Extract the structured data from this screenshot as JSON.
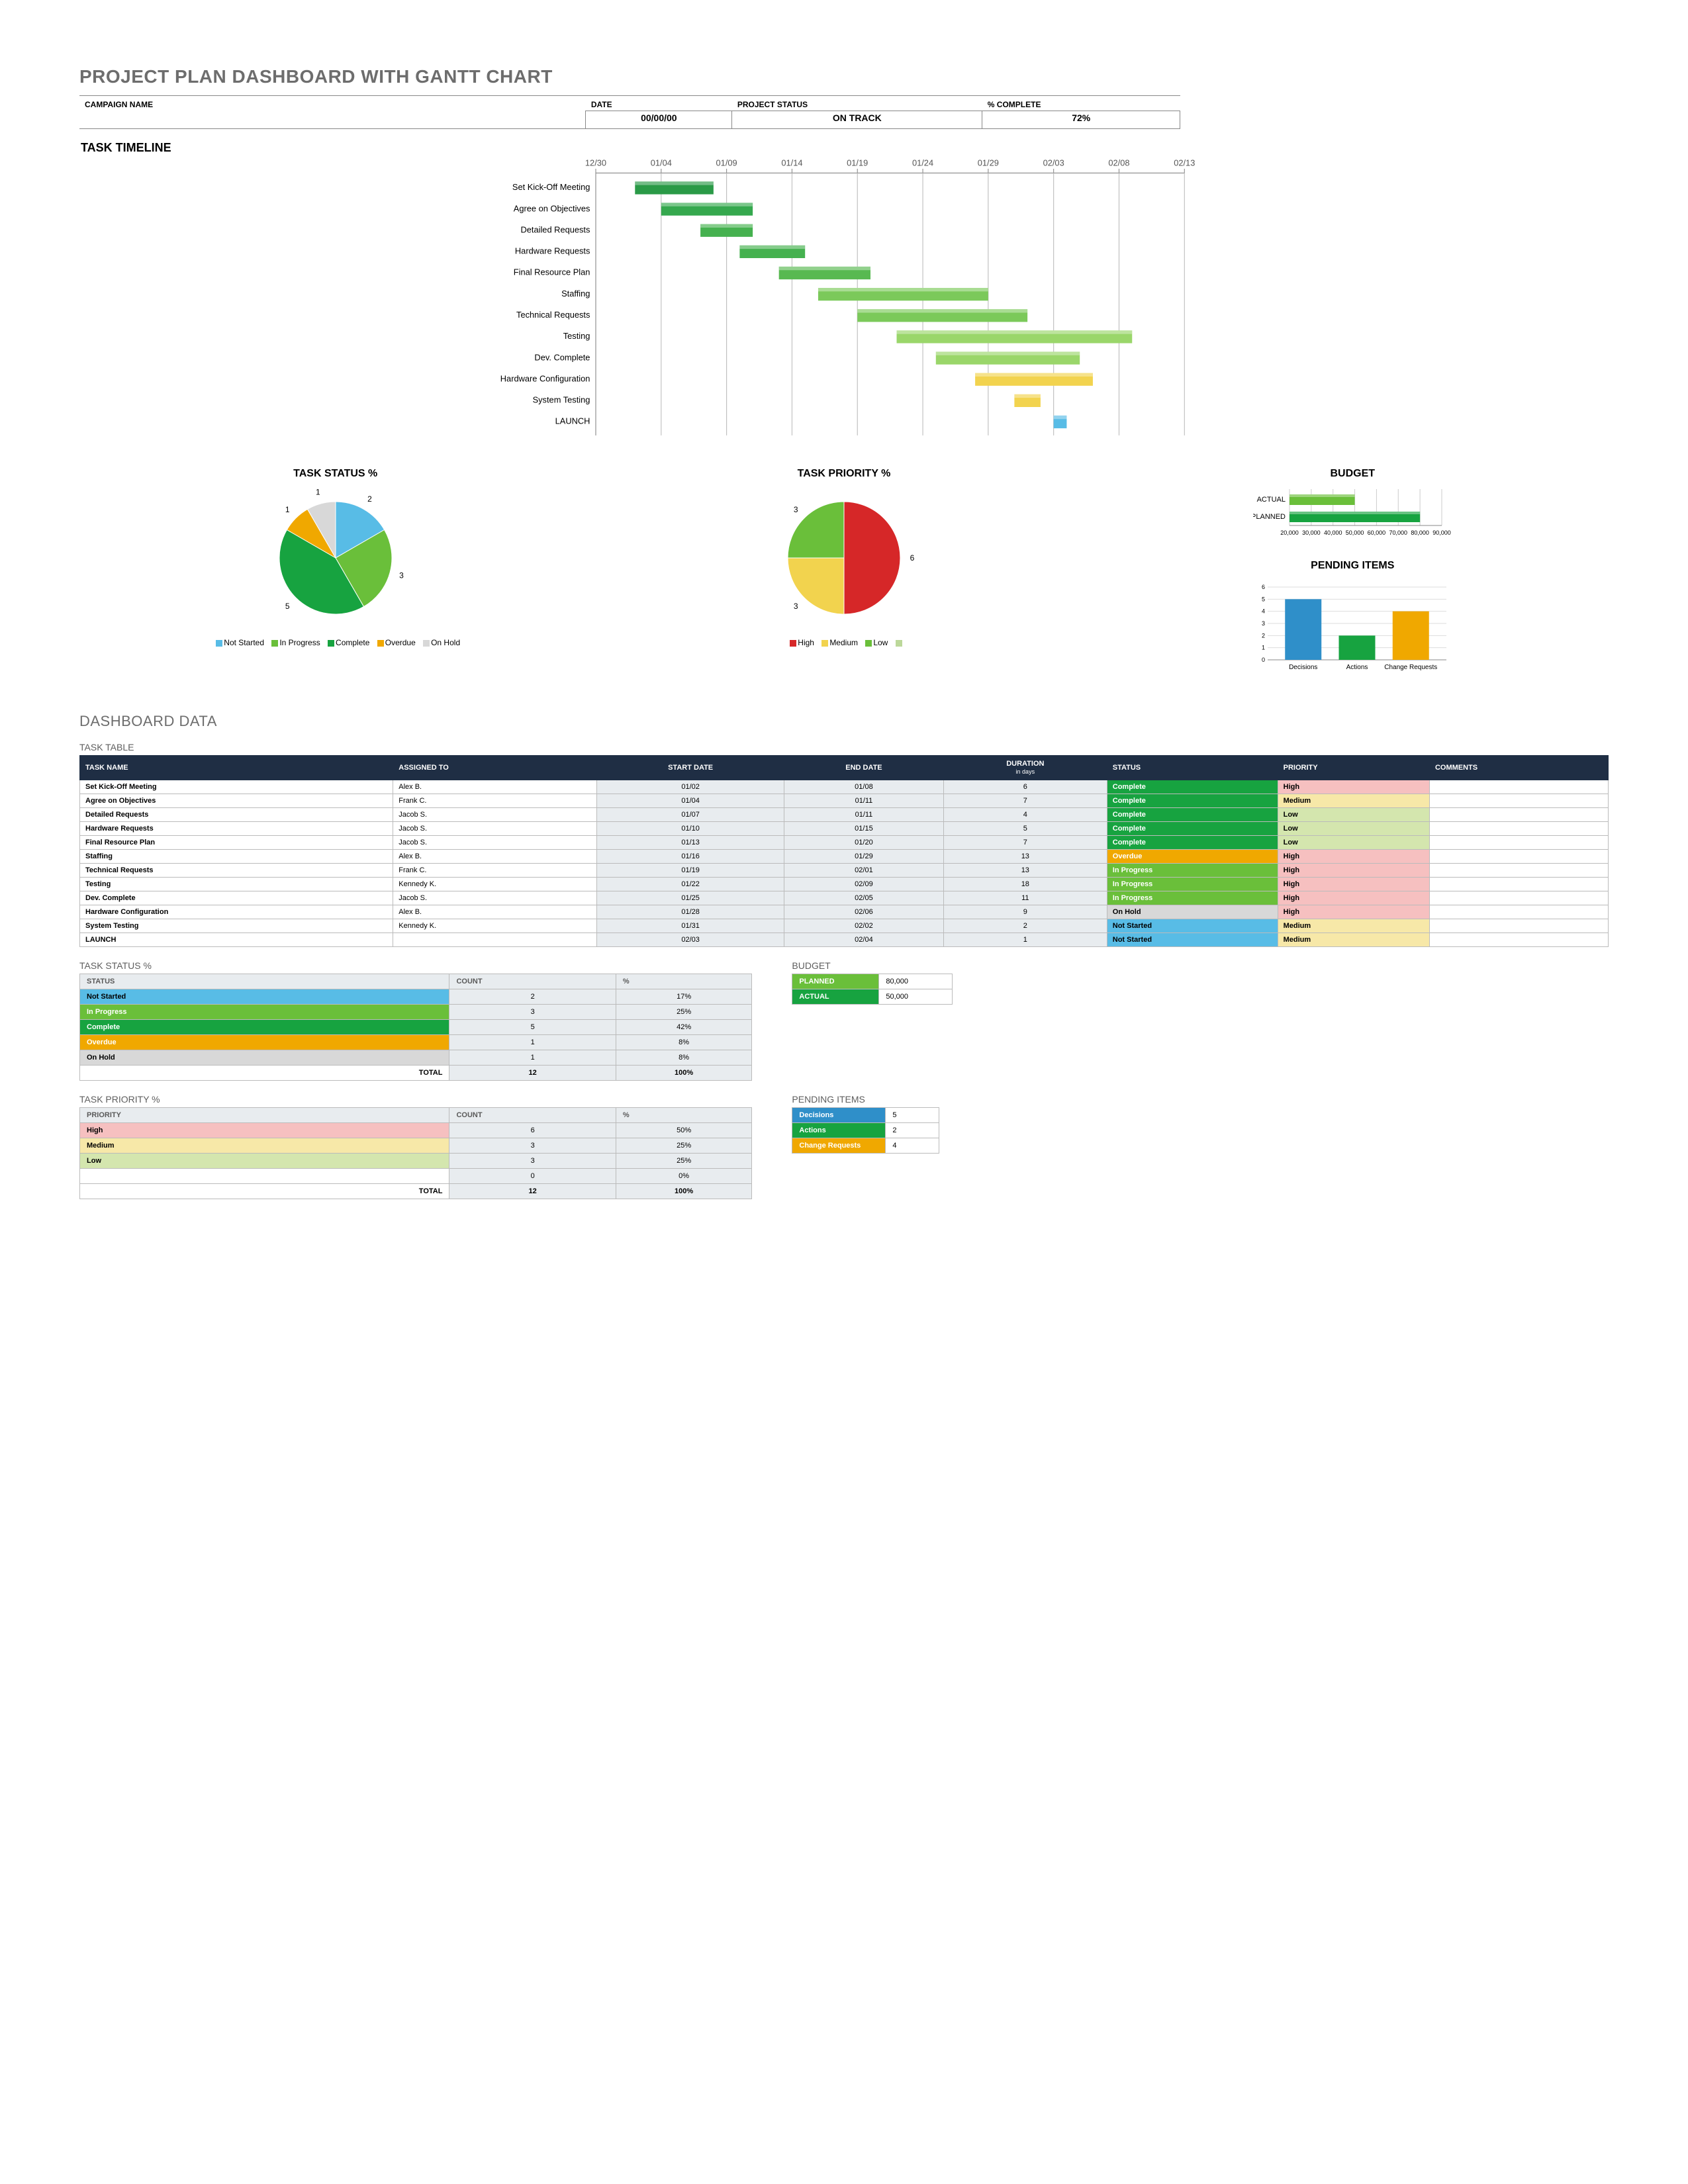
{
  "header": {
    "title": "PROJECT PLAN DASHBOARD WITH GANTT CHART",
    "campaign_label": "CAMPAIGN NAME",
    "date_label": "DATE",
    "status_label": "PROJECT STATUS",
    "pct_label": "% COMPLETE",
    "date_value": "00/00/00",
    "status_value": "ON TRACK",
    "pct_value": "72%"
  },
  "gantt": {
    "title": "TASK TIMELINE",
    "ticks": [
      "12/30",
      "01/04",
      "01/09",
      "01/14",
      "01/19",
      "01/24",
      "01/29",
      "02/03",
      "02/08",
      "02/13"
    ]
  },
  "tasks": [
    {
      "name": "Set Kick-Off Meeting",
      "assigned": "Alex B.",
      "start": "01/02",
      "end": "01/08",
      "dur": "6",
      "start_i": 0.6,
      "dur_i": 6,
      "status": "Complete",
      "priority": "High",
      "bar": "g1"
    },
    {
      "name": "Agree on Objectives",
      "assigned": "Frank C.",
      "start": "01/04",
      "end": "01/11",
      "dur": "7",
      "start_i": 1.0,
      "dur_i": 7,
      "status": "Complete",
      "priority": "Medium",
      "bar": "g2"
    },
    {
      "name": "Detailed Requests",
      "assigned": "Jacob S.",
      "start": "01/07",
      "end": "01/11",
      "dur": "4",
      "start_i": 1.6,
      "dur_i": 4,
      "status": "Complete",
      "priority": "Low",
      "bar": "g3"
    },
    {
      "name": "Hardware Requests",
      "assigned": "Jacob S.",
      "start": "01/10",
      "end": "01/15",
      "dur": "5",
      "start_i": 2.2,
      "dur_i": 5,
      "status": "Complete",
      "priority": "Low",
      "bar": "g3"
    },
    {
      "name": "Final Resource Plan",
      "assigned": "Jacob S.",
      "start": "01/13",
      "end": "01/20",
      "dur": "7",
      "start_i": 2.8,
      "dur_i": 7,
      "status": "Complete",
      "priority": "Low",
      "bar": "g4"
    },
    {
      "name": "Staffing",
      "assigned": "Alex B.",
      "start": "01/16",
      "end": "01/29",
      "dur": "13",
      "start_i": 3.4,
      "dur_i": 13,
      "status": "Overdue",
      "priority": "High",
      "bar": "g5"
    },
    {
      "name": "Technical Requests",
      "assigned": "Frank C.",
      "start": "01/19",
      "end": "02/01",
      "dur": "13",
      "start_i": 4.0,
      "dur_i": 13,
      "status": "In Progress",
      "priority": "High",
      "bar": "g5"
    },
    {
      "name": "Testing",
      "assigned": "Kennedy K.",
      "start": "01/22",
      "end": "02/09",
      "dur": "18",
      "start_i": 4.6,
      "dur_i": 18,
      "status": "In Progress",
      "priority": "High",
      "bar": "g6"
    },
    {
      "name": "Dev. Complete",
      "assigned": "Jacob S.",
      "start": "01/25",
      "end": "02/05",
      "dur": "11",
      "start_i": 5.2,
      "dur_i": 11,
      "status": "In Progress",
      "priority": "High",
      "bar": "g6"
    },
    {
      "name": "Hardware Configuration",
      "assigned": "Alex B.",
      "start": "01/28",
      "end": "02/06",
      "dur": "9",
      "start_i": 5.8,
      "dur_i": 9,
      "status": "On Hold",
      "priority": "High",
      "bar": "y1"
    },
    {
      "name": "System Testing",
      "assigned": "Kennedy K.",
      "start": "01/31",
      "end": "02/02",
      "dur": "2",
      "start_i": 6.4,
      "dur_i": 2,
      "status": "Not Started",
      "priority": "Medium",
      "bar": "y1"
    },
    {
      "name": "LAUNCH",
      "assigned": "",
      "start": "02/03",
      "end": "02/04",
      "dur": "1",
      "start_i": 7.0,
      "dur_i": 1,
      "status": "Not Started",
      "priority": "Medium",
      "bar": "b1"
    }
  ],
  "chart_data": [
    {
      "id": "task_status_pie",
      "type": "pie",
      "title": "TASK STATUS %",
      "slices": [
        {
          "label": "Not Started",
          "value": 2,
          "color": "#58bce6"
        },
        {
          "label": "In Progress",
          "value": 3,
          "color": "#6abf3a"
        },
        {
          "label": "Complete",
          "value": 5,
          "color": "#17a340"
        },
        {
          "label": "Overdue",
          "value": 1,
          "color": "#f0a800"
        },
        {
          "label": "On Hold",
          "value": 1,
          "color": "#d8d8d8"
        }
      ]
    },
    {
      "id": "task_priority_pie",
      "type": "pie",
      "title": "TASK PRIORITY %",
      "slices": [
        {
          "label": "High",
          "value": 6,
          "color": "#d62728"
        },
        {
          "label": "Medium",
          "value": 3,
          "color": "#f2d34e"
        },
        {
          "label": "Low",
          "value": 3,
          "color": "#6abf3a"
        },
        {
          "label": "",
          "value": 0,
          "color": "#bcd89a"
        }
      ]
    },
    {
      "id": "budget_bar",
      "type": "bar",
      "title": "BUDGET",
      "categories": [
        "ACTUAL",
        "PLANNED"
      ],
      "values": [
        50000,
        80000
      ],
      "xlim": [
        20000,
        90000
      ],
      "ticks": [
        20000,
        30000,
        40000,
        50000,
        60000,
        70000,
        80000,
        90000
      ]
    },
    {
      "id": "pending_bar",
      "type": "bar",
      "title": "PENDING ITEMS",
      "categories": [
        "Decisions",
        "Actions",
        "Change Requests"
      ],
      "values": [
        5,
        2,
        4
      ],
      "colors": [
        "#2f8fc9",
        "#17a340",
        "#f0a800"
      ],
      "ylim": [
        0,
        6
      ]
    }
  ],
  "dashboard_data_title": "DASHBOARD DATA",
  "task_table": {
    "title": "TASK TABLE",
    "headers": [
      "TASK NAME",
      "ASSIGNED TO",
      "START DATE",
      "END DATE",
      "DURATION in days",
      "STATUS",
      "PRIORITY",
      "COMMENTS"
    ]
  },
  "status_table": {
    "title": "TASK STATUS %",
    "headers": [
      "STATUS",
      "COUNT",
      "%"
    ],
    "rows": [
      {
        "label": "Not Started",
        "count": 2,
        "pct": "17%",
        "cls": "bg-notstart"
      },
      {
        "label": "In Progress",
        "count": 3,
        "pct": "25%",
        "cls": "bg-inprog"
      },
      {
        "label": "Complete",
        "count": 5,
        "pct": "42%",
        "cls": "bg-complete"
      },
      {
        "label": "Overdue",
        "count": 1,
        "pct": "8%",
        "cls": "bg-overdue"
      },
      {
        "label": "On Hold",
        "count": 1,
        "pct": "8%",
        "cls": "bg-onhold"
      }
    ],
    "total_label": "TOTAL",
    "total_count": "12",
    "total_pct": "100%"
  },
  "priority_table": {
    "title": "TASK PRIORITY %",
    "headers": [
      "PRIORITY",
      "COUNT",
      "%"
    ],
    "rows": [
      {
        "label": "High",
        "count": 6,
        "pct": "50%",
        "cls": "bg-high"
      },
      {
        "label": "Medium",
        "count": 3,
        "pct": "25%",
        "cls": "bg-med"
      },
      {
        "label": "Low",
        "count": 3,
        "pct": "25%",
        "cls": "bg-low"
      },
      {
        "label": "",
        "count": 0,
        "pct": "0%",
        "cls": ""
      }
    ],
    "total_label": "TOTAL",
    "total_count": "12",
    "total_pct": "100%"
  },
  "budget_table": {
    "title": "BUDGET",
    "rows": [
      {
        "label": "PLANNED",
        "value": "80,000",
        "cls": "bg-inprog"
      },
      {
        "label": "ACTUAL",
        "value": "50,000",
        "cls": "bg-complete"
      }
    ]
  },
  "pending_table": {
    "title": "PENDING ITEMS",
    "rows": [
      {
        "label": "Decisions",
        "value": 5,
        "bg": "#2f8fc9"
      },
      {
        "label": "Actions",
        "value": 2,
        "bg": "#17a340"
      },
      {
        "label": "Change Requests",
        "value": 4,
        "bg": "#f0a800"
      }
    ]
  },
  "colors": {
    "g1": "#2a9a47",
    "g2": "#35a84e",
    "g3": "#45b14f",
    "g4": "#58b951",
    "g5": "#7bc95a",
    "g6": "#9ad66a",
    "y1": "#f2d34e",
    "b1": "#58bce6"
  }
}
